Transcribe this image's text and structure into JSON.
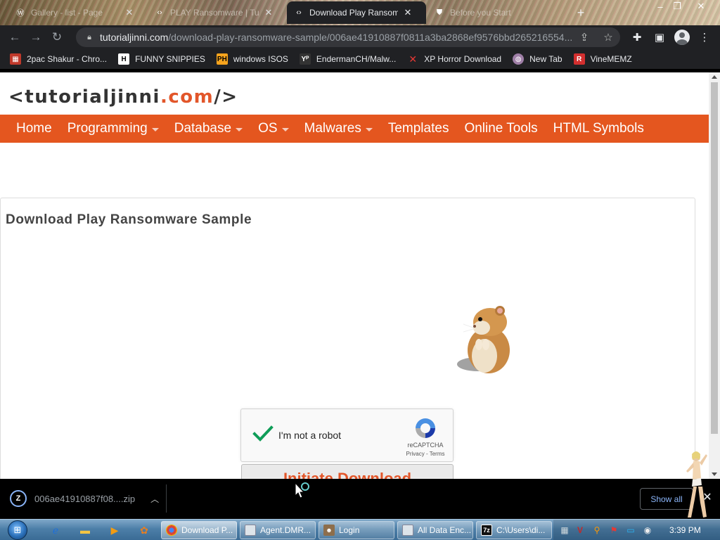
{
  "browser": {
    "tabs": [
      {
        "title": "Gallery - list - Page",
        "icon": "wordpress-icon",
        "active": false
      },
      {
        "title": "PLAY Ransomware | Tuto",
        "icon": "code-icon",
        "active": false
      },
      {
        "title": "Download Play Ransomware",
        "icon": "code-icon",
        "active": true
      },
      {
        "title": "Before you Start",
        "icon": "shield-icon",
        "active": false
      }
    ],
    "url_host": "tutorialjinni.com",
    "url_path": "/download-play-ransomware-sample/006ae41910887f0811a3ba2868ef9576bbd265216554...",
    "bookmarks": [
      {
        "label": "2pac Shakur - Chro...",
        "icon": "store-icon",
        "color": "#c0392b"
      },
      {
        "label": "FUNNY SNIPPIES",
        "icon": "h-icon",
        "color": "#ffffff"
      },
      {
        "label": "windows ISOS",
        "icon": "ph-icon",
        "color": "#f7a41d"
      },
      {
        "label": "EndermanCH/Malw...",
        "icon": "yp-icon",
        "color": "#2b2b2b"
      },
      {
        "label": "XP Horror Download",
        "icon": "x-icon",
        "color": "#e53935"
      },
      {
        "label": "New Tab",
        "icon": "globe-icon",
        "color": "#9e7ea6"
      },
      {
        "label": "VineMEMZ",
        "icon": "r-icon",
        "color": "#d32f2f"
      }
    ]
  },
  "site": {
    "logo_prefix": "<tutorialjinni",
    "logo_tld": ".com",
    "logo_suffix": "/>",
    "nav": [
      {
        "label": "Home",
        "dropdown": false
      },
      {
        "label": "Programming",
        "dropdown": true
      },
      {
        "label": "Database",
        "dropdown": true
      },
      {
        "label": "OS",
        "dropdown": true
      },
      {
        "label": "Malwares",
        "dropdown": true
      },
      {
        "label": "Templates",
        "dropdown": false
      },
      {
        "label": "Online Tools",
        "dropdown": false
      },
      {
        "label": "HTML Symbols",
        "dropdown": false
      }
    ],
    "accent": "#e4561f",
    "page_title": "Download Play Ransomware Sample",
    "captcha": {
      "label": "I'm not a robot",
      "brand": "reCAPTCHA",
      "links": "Privacy - Terms",
      "checked": true
    },
    "download_button": "Initiate Download"
  },
  "download_bar": {
    "filename": "006ae41910887f08....zip",
    "show_all": "Show all"
  },
  "taskbar": {
    "tasks": [
      {
        "label": "Download P...",
        "icon": "chrome-icon",
        "active": true
      },
      {
        "label": "Agent.DMR...",
        "icon": "window-icon",
        "active": false
      },
      {
        "label": "Login",
        "icon": "user-icon",
        "active": false
      },
      {
        "label": "All Data Enc...",
        "icon": "window-icon",
        "active": false
      },
      {
        "label": "C:\\Users\\di...",
        "icon": "7zip-icon",
        "active": false
      }
    ],
    "time": "3:39 PM"
  }
}
